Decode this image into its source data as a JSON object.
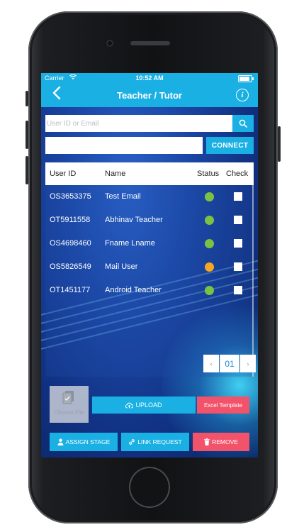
{
  "status_bar": {
    "carrier": "Carrier",
    "time": "10:52 AM"
  },
  "navbar": {
    "back_icon": "chevron-left-icon",
    "title": "Teacher / Tutor",
    "info_icon": "info-icon",
    "info_glyph": "i"
  },
  "search": {
    "placeholder": "User ID or Email",
    "value": "",
    "button_icon": "search-icon"
  },
  "connect": {
    "code_value": "",
    "button_label": "CONNECT"
  },
  "table": {
    "headers": {
      "user_id": "User ID",
      "name": "Name",
      "status": "Status",
      "check": "Check"
    },
    "rows": [
      {
        "user_id": "OS3653375",
        "name": "Test Email",
        "status": "green",
        "checked": false
      },
      {
        "user_id": "OT5911558",
        "name": "Abhinav Teacher",
        "status": "green",
        "checked": false
      },
      {
        "user_id": "OS4698460",
        "name": "Fname Lname",
        "status": "green",
        "checked": false
      },
      {
        "user_id": "OS5826549",
        "name": "Mail User",
        "status": "orange",
        "checked": false
      },
      {
        "user_id": "OT1451177",
        "name": "Android Teacher",
        "status": "green",
        "checked": false
      }
    ]
  },
  "pagination": {
    "prev": "‹",
    "page": "01",
    "next": "›"
  },
  "actions": {
    "choose_file": "Choose File",
    "upload": "UPLOAD",
    "excel_template": "Excel Template",
    "assign_stage": "ASSIGN STAGE",
    "link_request": "LINK REQUEST",
    "remove": "REMOVE"
  },
  "colors": {
    "accent": "#1bb0e4",
    "danger": "#f2536a",
    "status_green": "#7cc242",
    "status_orange": "#f5a623"
  }
}
